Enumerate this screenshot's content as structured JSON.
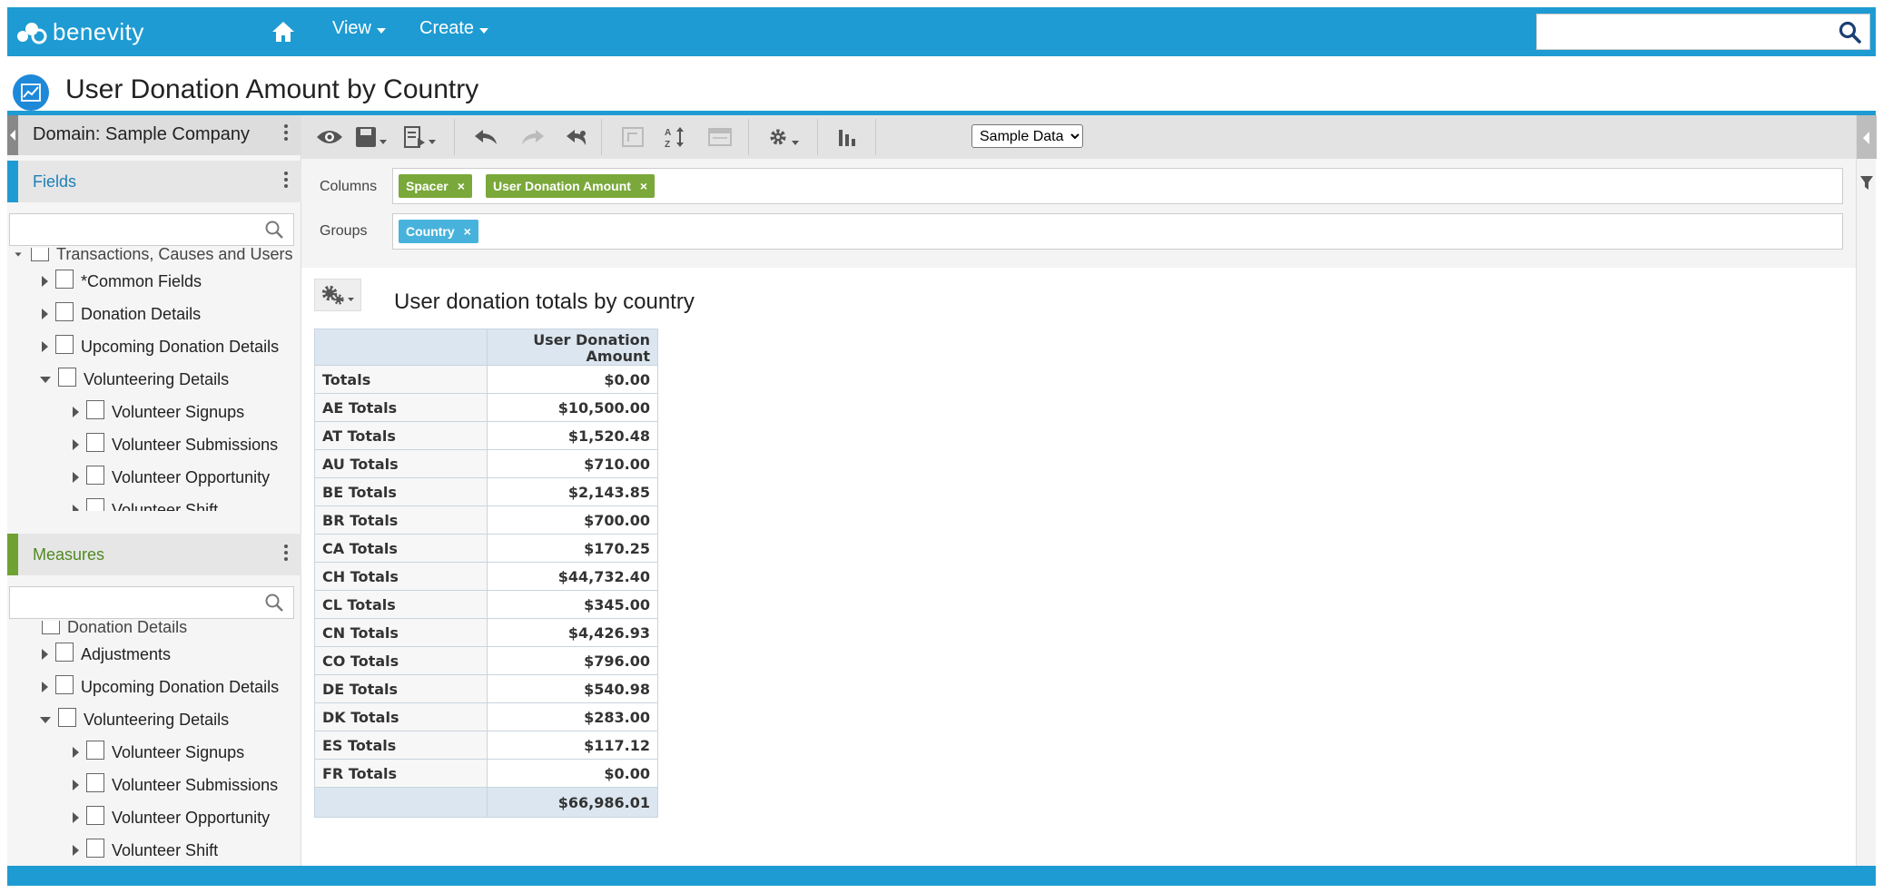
{
  "app": {
    "brand": "benevity",
    "brand_color": "#1e9bd2"
  },
  "nav": {
    "view_label": "View",
    "create_label": "Create",
    "search_placeholder": ""
  },
  "page": {
    "title": "User Donation Amount by Country"
  },
  "left_panel": {
    "domain_label": "Domain: Sample Company",
    "fields": {
      "label": "Fields",
      "accent": "#1e9bd2",
      "filter_value": "",
      "partial_item": "Transactions, Causes and Users",
      "items": [
        {
          "label": "*Common Fields"
        },
        {
          "label": "Donation Details"
        },
        {
          "label": "Upcoming Donation Details"
        },
        {
          "label": "Volunteering Details"
        },
        {
          "label": "Volunteer Signups"
        },
        {
          "label": "Volunteer Submissions"
        },
        {
          "label": "Volunteer Opportunity"
        },
        {
          "label": "Volunteer Shift"
        }
      ]
    },
    "measures": {
      "label": "Measures",
      "accent": "#6fa233",
      "filter_value": "",
      "partial_item": "Donation Details",
      "items": [
        {
          "label": "Adjustments"
        },
        {
          "label": "Upcoming Donation Details"
        },
        {
          "label": "Volunteering Details"
        },
        {
          "label": "Volunteer Signups"
        },
        {
          "label": "Volunteer Submissions"
        },
        {
          "label": "Volunteer Opportunity"
        },
        {
          "label": "Volunteer Shift"
        }
      ]
    }
  },
  "toolbar": {
    "data_source_options": [
      "Sample Data"
    ],
    "data_source_selected": "Sample Data"
  },
  "columns": {
    "label": "Columns",
    "chips": [
      "Spacer",
      "User Donation Amount"
    ]
  },
  "groups": {
    "label": "Groups",
    "chips": [
      "Country"
    ]
  },
  "report": {
    "title": "User donation totals by country",
    "header": "User Donation Amount",
    "rows": [
      {
        "label": "Totals",
        "value": "$0.00"
      },
      {
        "label": "AE Totals",
        "value": "$10,500.00"
      },
      {
        "label": "AT Totals",
        "value": "$1,520.48"
      },
      {
        "label": "AU Totals",
        "value": "$710.00"
      },
      {
        "label": "BE Totals",
        "value": "$2,143.85"
      },
      {
        "label": "BR Totals",
        "value": "$700.00"
      },
      {
        "label": "CA Totals",
        "value": "$170.25"
      },
      {
        "label": "CH Totals",
        "value": "$44,732.40"
      },
      {
        "label": "CL Totals",
        "value": "$345.00"
      },
      {
        "label": "CN Totals",
        "value": "$4,426.93"
      },
      {
        "label": "CO Totals",
        "value": "$796.00"
      },
      {
        "label": "DE Totals",
        "value": "$540.98"
      },
      {
        "label": "DK Totals",
        "value": "$283.00"
      },
      {
        "label": "ES Totals",
        "value": "$117.12"
      },
      {
        "label": "FR Totals",
        "value": "$0.00"
      }
    ],
    "grand_total": "$66,986.01"
  }
}
